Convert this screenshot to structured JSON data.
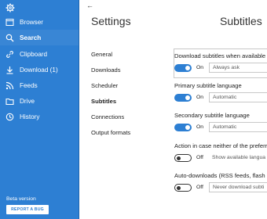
{
  "sidebar": {
    "items": [
      {
        "label": "Browser",
        "icon": "browser-icon"
      },
      {
        "label": "Search",
        "icon": "search-icon",
        "active": true
      },
      {
        "label": "Clipboard",
        "icon": "clipboard-icon"
      },
      {
        "label": "Download  (1)",
        "icon": "download-icon"
      },
      {
        "label": "Feeds",
        "icon": "feeds-icon"
      },
      {
        "label": "Drive",
        "icon": "drive-icon"
      },
      {
        "label": "History",
        "icon": "history-icon"
      }
    ],
    "beta_label": "Beta version",
    "report_button": "REPORT A BUG",
    "background_color": "#2d7fd3"
  },
  "header": {
    "back": "←",
    "settings_title": "Settings",
    "page_title": "Subtitles"
  },
  "settings_menu": [
    {
      "label": "General"
    },
    {
      "label": "Downloads"
    },
    {
      "label": "Scheduler"
    },
    {
      "label": "Subtitles",
      "active": true
    },
    {
      "label": "Connections"
    },
    {
      "label": "Output formats"
    }
  ],
  "options": [
    {
      "label": "Download subtitles when available",
      "toggle_state": "On",
      "select_value": "Always ask",
      "enabled": true
    },
    {
      "label": "Primary subtitle language",
      "toggle_state": "On",
      "select_value": "Automatic",
      "enabled": true
    },
    {
      "label": "Secondary subtitle language",
      "toggle_state": "On",
      "select_value": "Automatic",
      "enabled": true
    },
    {
      "label": "Action in case neither of the preferr",
      "toggle_state": "Off",
      "select_value": "Show available langua",
      "enabled": false
    },
    {
      "label": "Auto-downloads (RSS feeds, flash a",
      "toggle_state": "Off",
      "select_value": "Never download subti",
      "enabled": false
    }
  ]
}
